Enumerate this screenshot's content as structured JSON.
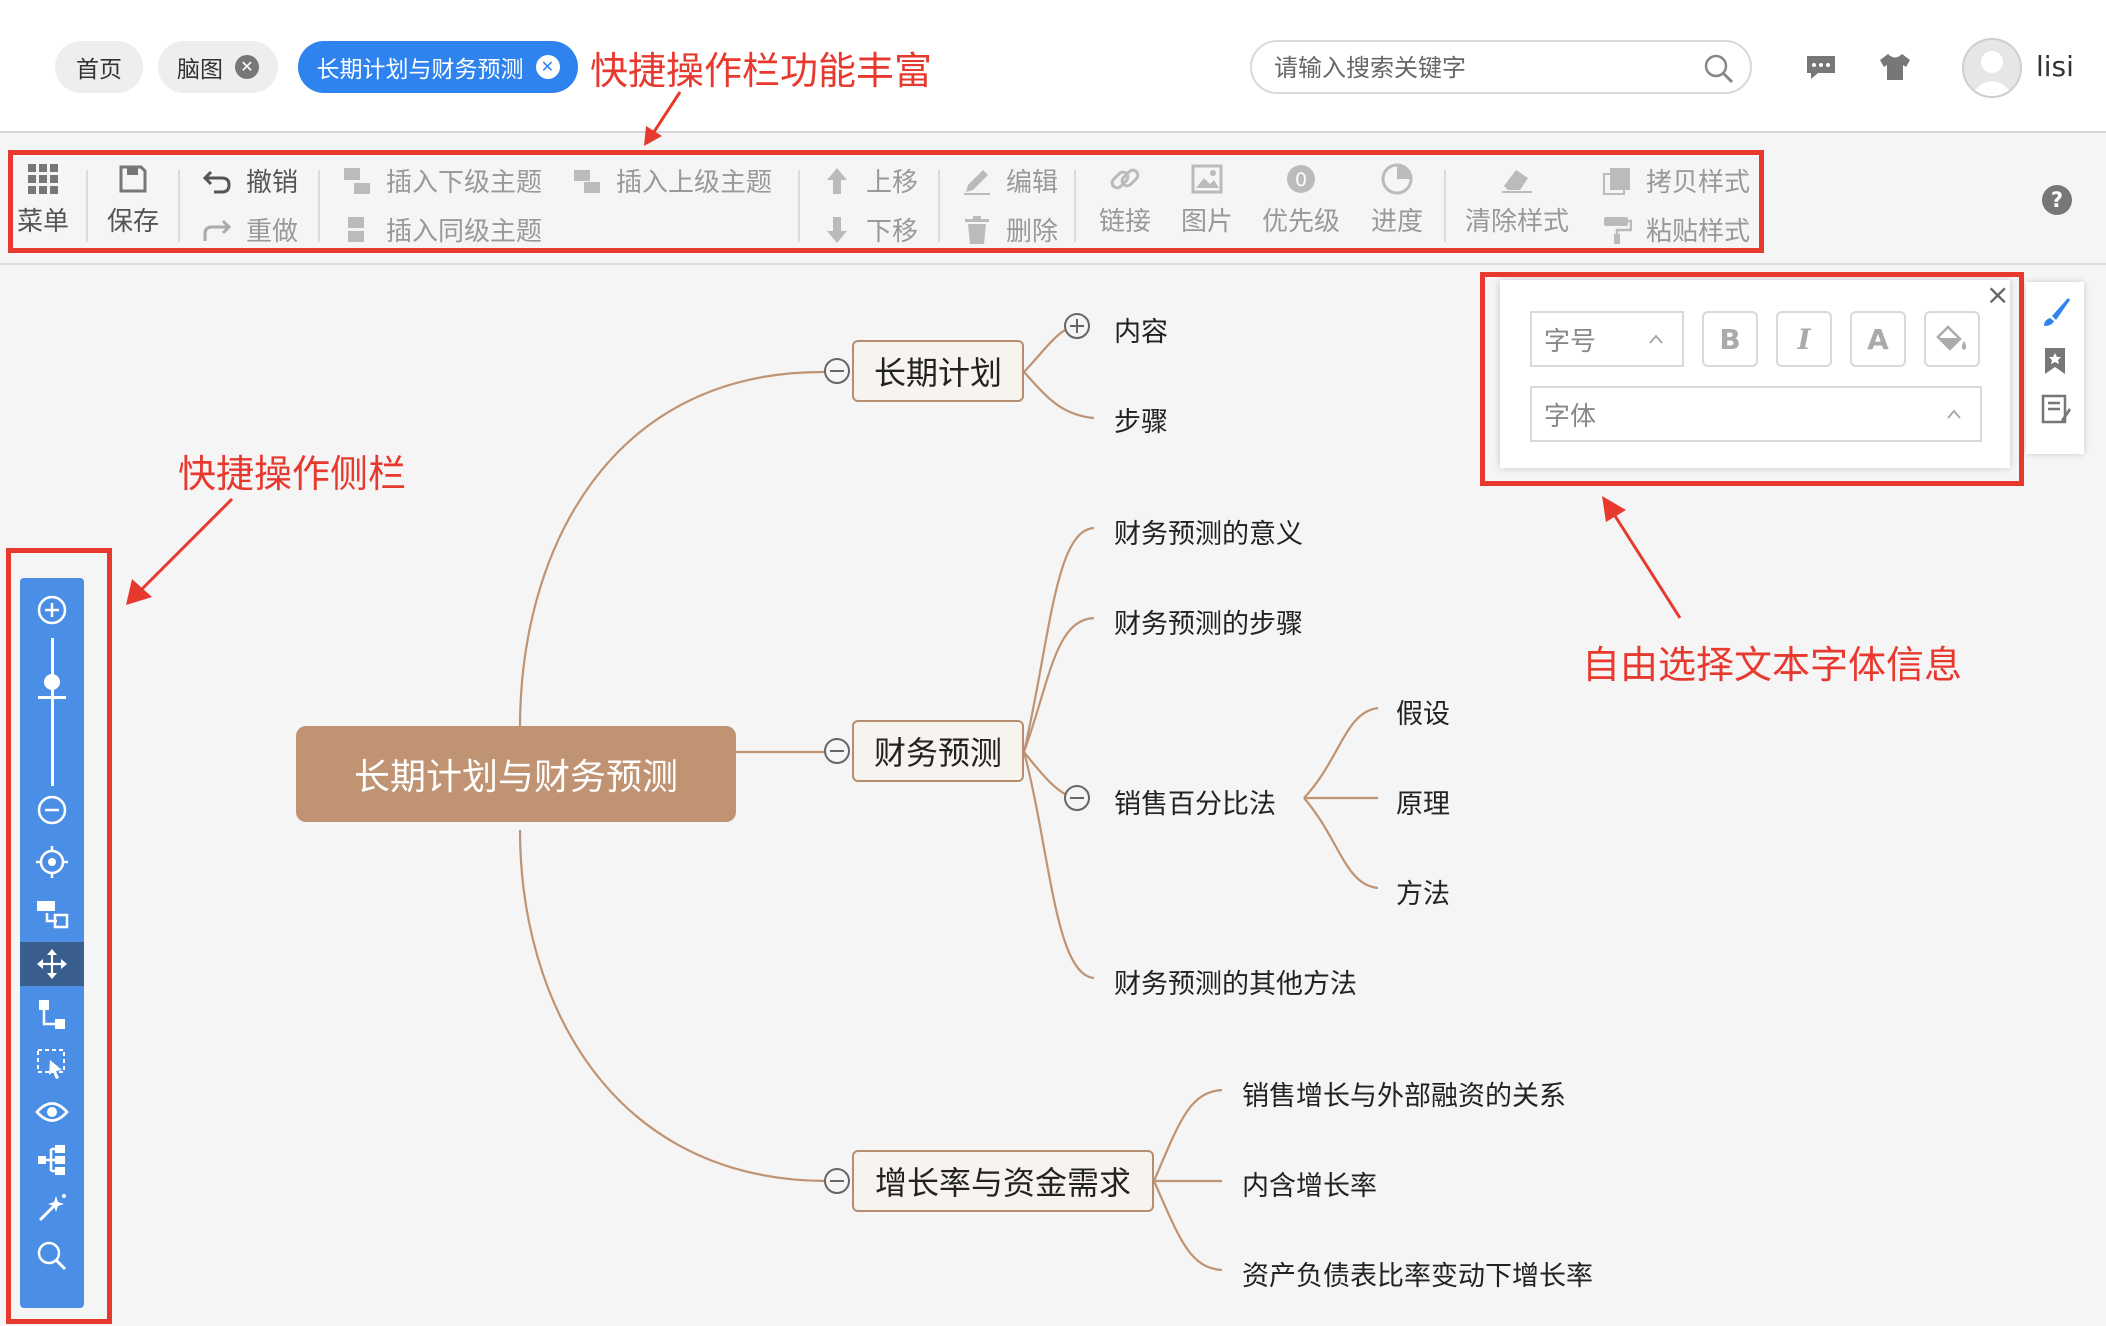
{
  "header": {
    "tabs": [
      {
        "label": "首页",
        "closable": false,
        "active": false
      },
      {
        "label": "脑图",
        "closable": true,
        "active": false
      },
      {
        "label": "长期计划与财务预测",
        "closable": true,
        "active": true
      }
    ],
    "search_placeholder": "请输入搜索关键字",
    "username": "lisi",
    "icons": [
      "search-icon",
      "message-icon",
      "shirt-icon",
      "user-avatar"
    ]
  },
  "toolbar": {
    "menu": "菜单",
    "save": "保存",
    "undo": "撤销",
    "redo": "重做",
    "insert_child": "插入下级主题",
    "insert_sibling": "插入同级主题",
    "insert_parent": "插入上级主题",
    "move_up": "上移",
    "move_down": "下移",
    "edit": "编辑",
    "delete": "删除",
    "link": "链接",
    "image": "图片",
    "priority": "优先级",
    "progress": "进度",
    "clear_style": "清除样式",
    "copy_style": "拷贝样式",
    "paste_style": "粘贴样式",
    "help": "?"
  },
  "annotations": {
    "toolbar_note": "快捷操作栏功能丰富",
    "sidebar_note": "快捷操作侧栏",
    "font_note": "自由选择文本字体信息"
  },
  "font_panel": {
    "size_placeholder": "字号",
    "family_placeholder": "字体",
    "bold": "B",
    "italic": "I",
    "font_color": "A",
    "close": "×"
  },
  "mindmap": {
    "root": "长期计划与财务预测",
    "branches": [
      {
        "label": "长期计划",
        "children": [
          "内容",
          "步骤"
        ]
      },
      {
        "label": "财务预测",
        "children": [
          "财务预测的意义",
          "财务预测的步骤",
          "销售百分比法",
          "财务预测的其他方法"
        ],
        "sub": {
          "parent": "销售百分比法",
          "children": [
            "假设",
            "原理",
            "方法"
          ]
        }
      },
      {
        "label": "增长率与资金需求",
        "children": [
          "销售增长与外部融资的关系",
          "内含增长率",
          "资产负债表比率变动下增长率"
        ]
      }
    ]
  },
  "colors": {
    "accent_blue": "#2f83ef",
    "annotation_red": "#e8392f",
    "root_fill": "#c09372",
    "branch_line": "#c09372",
    "sidebar_blue": "#4a8ee6"
  }
}
